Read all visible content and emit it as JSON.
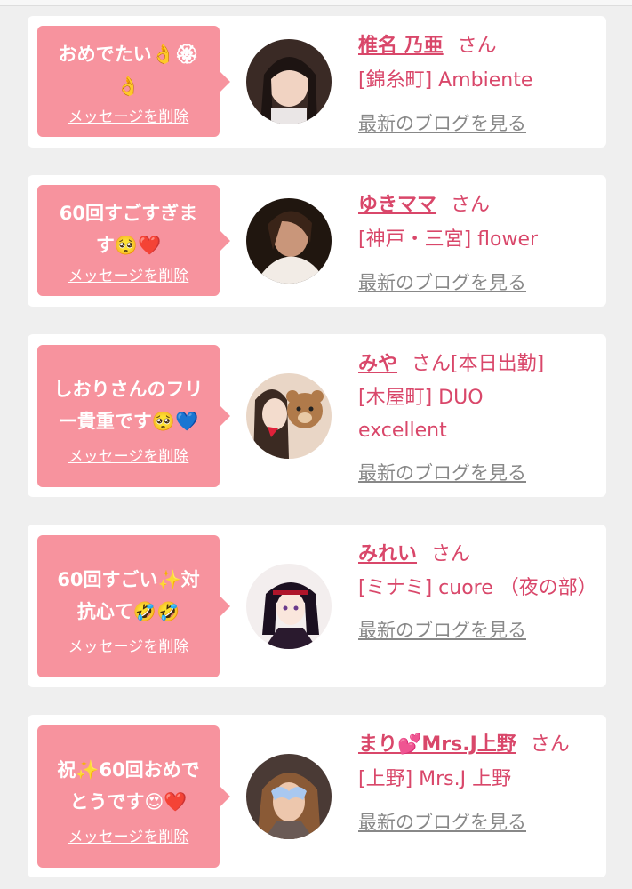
{
  "messages": [
    {
      "bubble_text": "おめでたい👌🏵\n👌",
      "delete_label": "メッセージを削除",
      "name": "椎名 乃亜",
      "suffix": "さん",
      "shop": "[錦糸町] Ambiente",
      "blog_label": "最新のブログを見る",
      "avatar_icon": "woman-portrait"
    },
    {
      "bubble_text": "60回すごすぎま\nす🥺❤️",
      "delete_label": "メッセージを削除",
      "name": "ゆきママ",
      "suffix": "さん",
      "shop": "[神戸・三宮] flower",
      "blog_label": "最新のブログを見る",
      "avatar_icon": "woman-portrait"
    },
    {
      "bubble_text": "しおりさんのフリ\nー貴重です🥺💙",
      "delete_label": "メッセージを削除",
      "name": "みや",
      "suffix": "さん[本日出勤]",
      "shop": "[木屋町] DUO excellent",
      "blog_label": "最新のブログを見る",
      "avatar_icon": "woman-portrait-with-bear"
    },
    {
      "bubble_text": "60回すごい✨対\n抗心て🤣🤣",
      "delete_label": "メッセージを削除",
      "name": "みれい",
      "suffix": "さん",
      "shop": "[ミナミ] cuore （夜の部）",
      "blog_label": "最新のブログを見る",
      "avatar_icon": "anime-character"
    },
    {
      "bubble_text": "祝✨60回おめで\nとうです😍❤️",
      "delete_label": "メッセージを削除",
      "name": "まり💕Mrs.J上野",
      "suffix": "さん",
      "shop": "[上野] Mrs.J 上野",
      "blog_label": "最新のブログを見る",
      "avatar_icon": "woman-portrait-masked"
    }
  ],
  "colors": {
    "bubble": "#f7939e",
    "accent": "#d9476a",
    "muted": "#888888",
    "page_bg": "#efefef",
    "card_bg": "#ffffff"
  }
}
